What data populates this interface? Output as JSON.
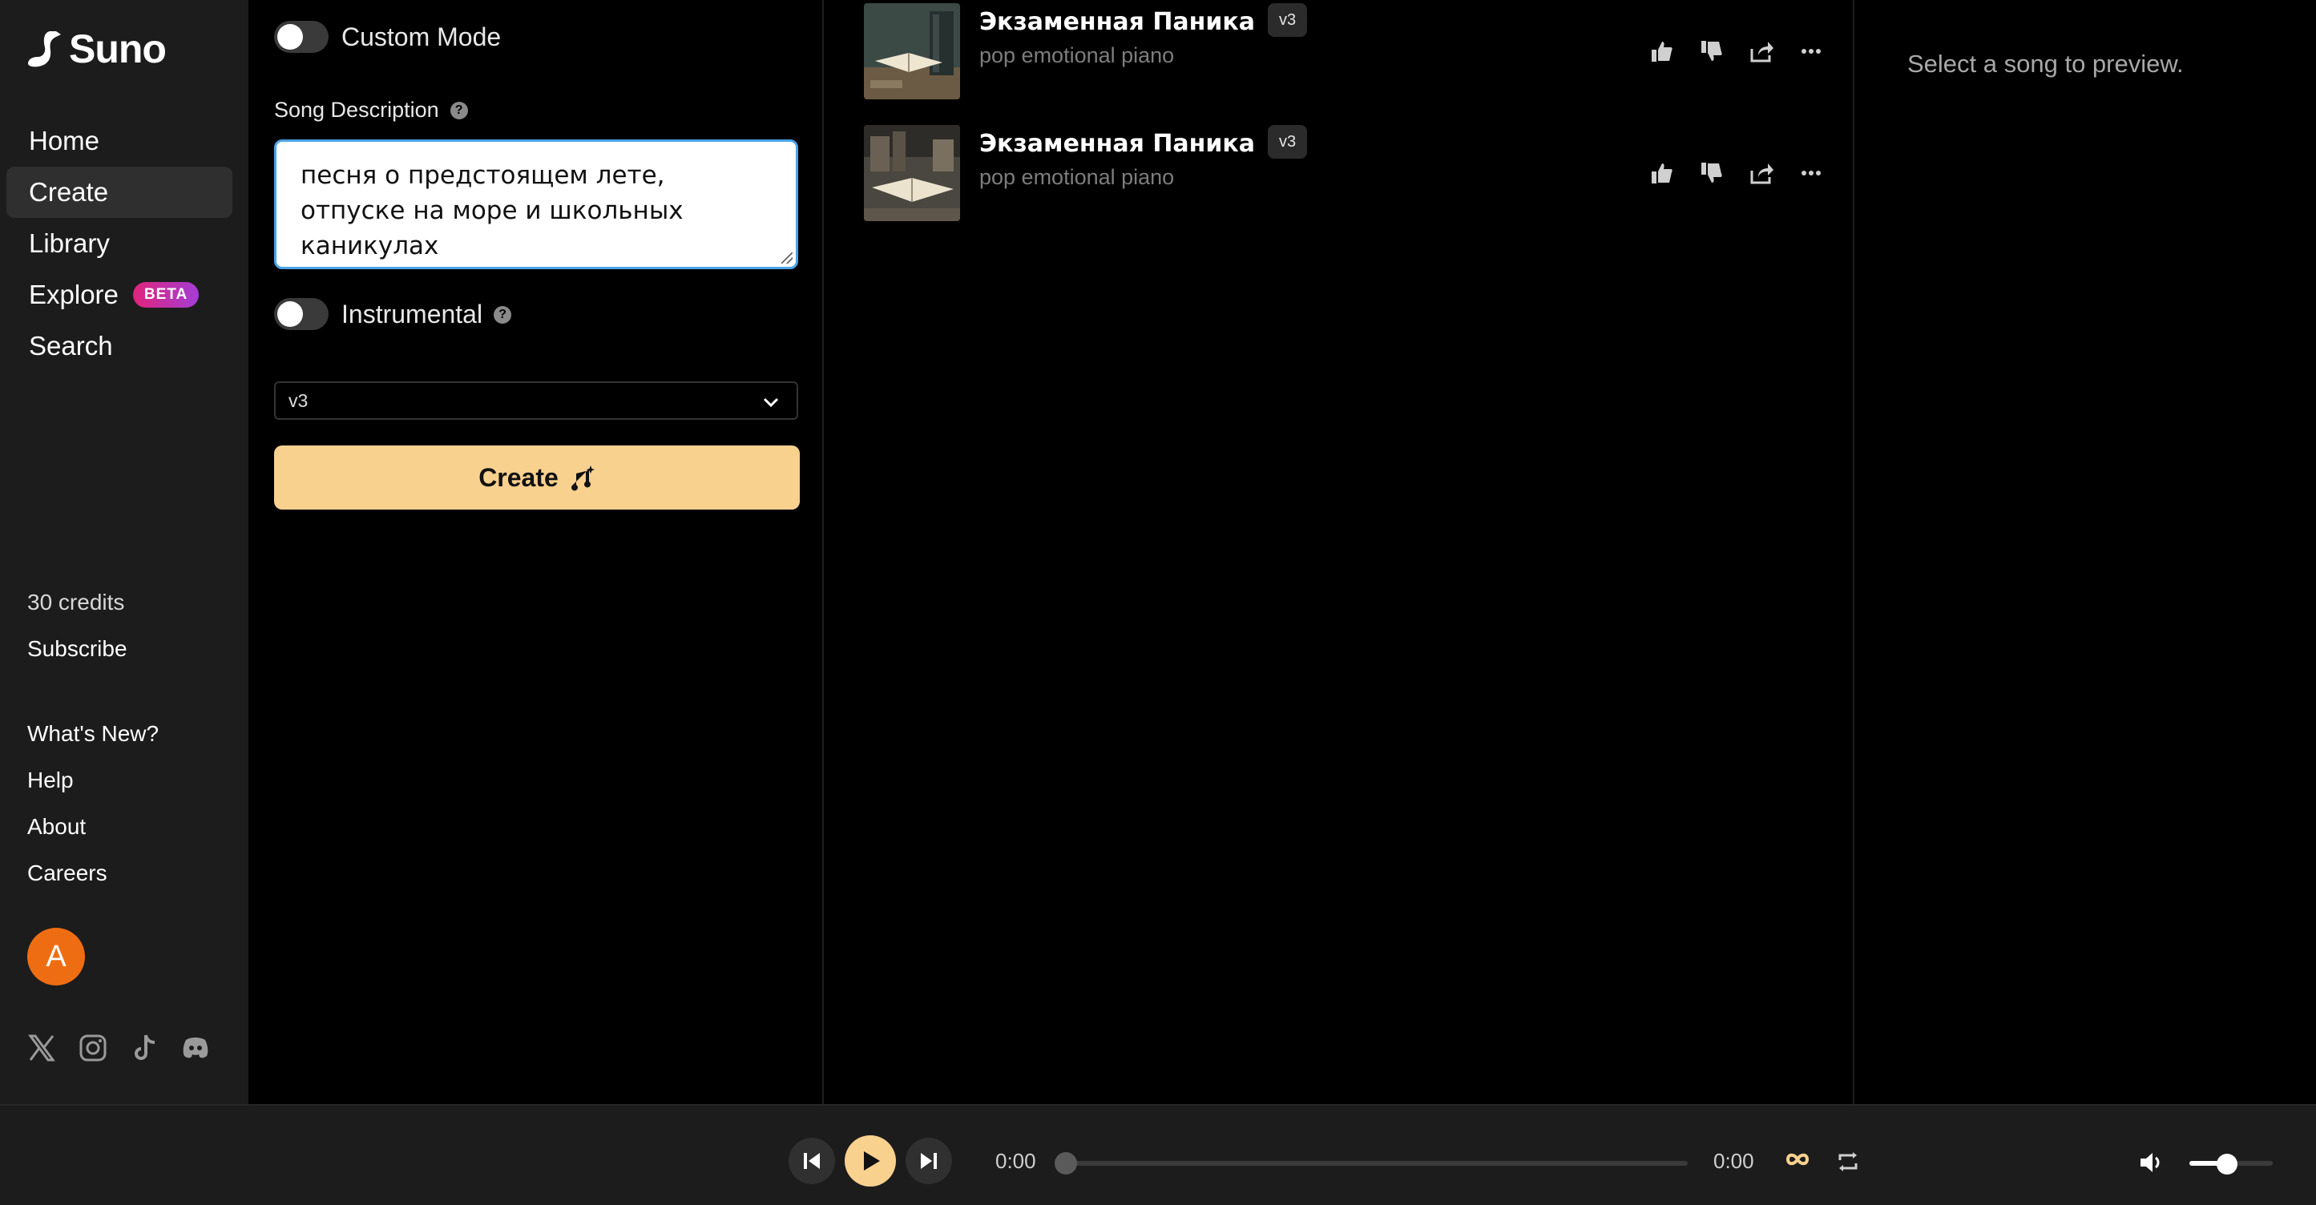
{
  "app": {
    "name": "Suno",
    "accent": "#f9d18f"
  },
  "nav": {
    "items": [
      {
        "label": "Home"
      },
      {
        "label": "Create",
        "active": true
      },
      {
        "label": "Library"
      },
      {
        "label": "Explore",
        "badge": "BETA"
      },
      {
        "label": "Search"
      }
    ]
  },
  "account": {
    "credits": "30 credits",
    "subscribe": "Subscribe",
    "avatar_initial": "A"
  },
  "footer_links": [
    "What's New?",
    "Help",
    "About",
    "Careers"
  ],
  "social_icons": [
    "x-icon",
    "instagram-icon",
    "tiktok-icon",
    "discord-icon"
  ],
  "create": {
    "custom_mode_label": "Custom Mode",
    "custom_mode_on": false,
    "description_label": "Song Description",
    "description_value": "песня о предстоящем лете, отпуске на море и школьных каникулах",
    "instrumental_label": "Instrumental",
    "instrumental_on": false,
    "model_value": "v3",
    "create_label": "Create"
  },
  "songs": [
    {
      "title": "Экзаменная Паника",
      "version": "v3",
      "tags": "pop emotional piano"
    },
    {
      "title": "Экзаменная Паника",
      "version": "v3",
      "tags": "pop emotional piano"
    }
  ],
  "preview": {
    "empty_text": "Select a song to preview."
  },
  "player": {
    "current_time": "0:00",
    "duration": "0:00",
    "progress": 0,
    "volume": 0.45
  }
}
